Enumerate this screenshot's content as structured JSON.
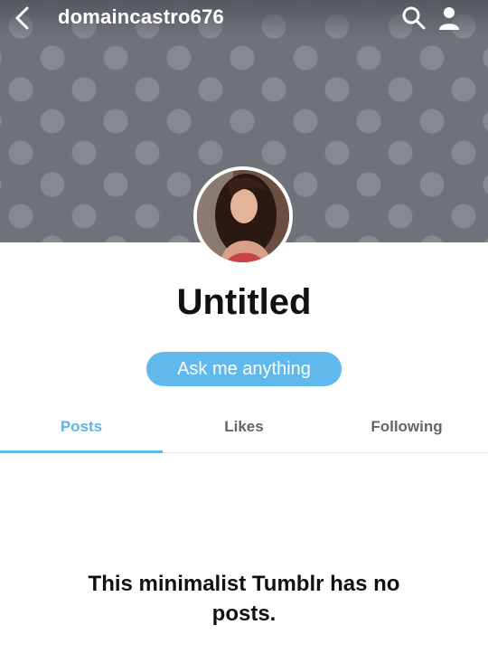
{
  "header": {
    "blog_name": "domaincastro676",
    "back_icon": "chevron-left-icon",
    "search_icon": "search-icon",
    "account_icon": "person-icon"
  },
  "profile": {
    "title": "Untitled",
    "ask_button_label": "Ask me anything"
  },
  "tabs": [
    {
      "label": "Posts",
      "active": true
    },
    {
      "label": "Likes",
      "active": false
    },
    {
      "label": "Following",
      "active": false
    }
  ],
  "content": {
    "empty_message": "This minimalist Tumblr has no posts."
  },
  "colors": {
    "accent": "#61b8ec",
    "header_bg": "#6f7379",
    "header_dots": "#868a90"
  }
}
